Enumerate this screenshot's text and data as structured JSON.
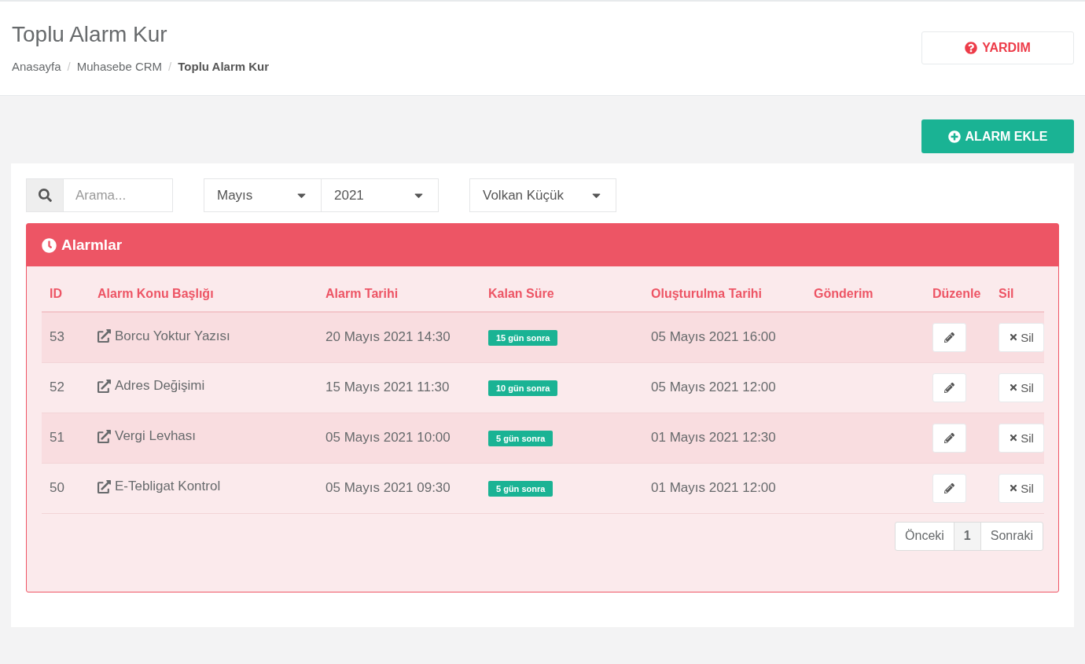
{
  "page": {
    "title": "Toplu Alarm Kur",
    "breadcrumb": [
      {
        "label": "Anasayfa",
        "current": false
      },
      {
        "label": "Muhasebe CRM",
        "current": false
      },
      {
        "label": "Toplu Alarm Kur",
        "current": true
      }
    ],
    "breadcrumb_separator": "/",
    "help_button": "YARDIM"
  },
  "add_button": "ALARM EKLE",
  "filters": {
    "search": {
      "placeholder": "Arama..."
    },
    "month": "Mayıs",
    "year": "2021",
    "user": "Volkan Küçük"
  },
  "panel": {
    "title": "Alarmlar",
    "table": {
      "columns": [
        "ID",
        "Alarm Konu Başlığı",
        "Alarm Tarihi",
        "Kalan Süre",
        "Oluşturulma Tarihi",
        "Gönderim",
        "Düzenle",
        "Sil"
      ],
      "rows": [
        {
          "id": "53",
          "title": "Borcu Yoktur Yazısı",
          "alarm_date": "20 Mayıs 2021 14:30",
          "remaining": "15 gün sonra",
          "created": "05 Mayıs 2021 16:00",
          "delete_label": "Sil"
        },
        {
          "id": "52",
          "title": "Adres Değişimi",
          "alarm_date": "15 Mayıs 2021 11:30",
          "remaining": "10 gün sonra",
          "created": "05 Mayıs 2021 12:00",
          "delete_label": "Sil"
        },
        {
          "id": "51",
          "title": "Vergi Levhası",
          "alarm_date": "05 Mayıs 2021 10:00",
          "remaining": "5 gün sonra",
          "created": "01 Mayıs 2021 12:30",
          "delete_label": "Sil"
        },
        {
          "id": "50",
          "title": "E-Tebligat Kontrol",
          "alarm_date": "05 Mayıs 2021 09:30",
          "remaining": "5 gün sonra",
          "created": "01 Mayıs 2021 12:00",
          "delete_label": "Sil"
        }
      ]
    },
    "pagination": [
      {
        "label": "Önceki",
        "selected": false
      },
      {
        "label": "1",
        "selected": true
      },
      {
        "label": "Sonraki",
        "selected": false
      }
    ]
  }
}
